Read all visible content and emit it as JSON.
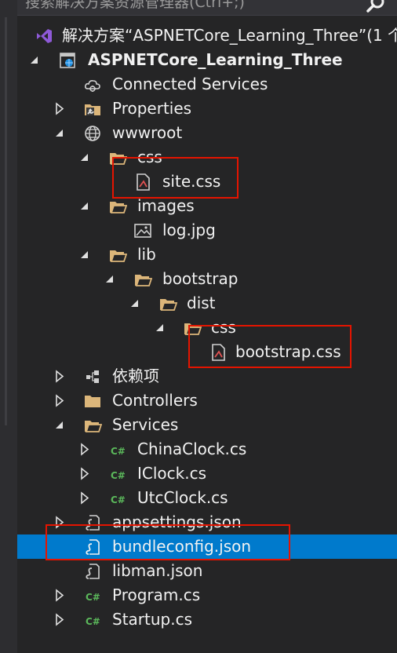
{
  "search": {
    "placeholder": "搜索解决方案资源管理器(Ctrl+;)"
  },
  "solution": {
    "label": "解决方案“ASPNETCore_Learning_Three”(1 个"
  },
  "project": {
    "label": "ASPNETCore_Learning_Three"
  },
  "tree": {
    "connected_services": "Connected Services",
    "properties": "Properties",
    "wwwroot": "wwwroot",
    "css": "css",
    "site_css": "site.css",
    "images": "images",
    "log_jpg": "log.jpg",
    "lib": "lib",
    "bootstrap": "bootstrap",
    "dist": "dist",
    "dist_css": "css",
    "bootstrap_css": "bootstrap.css",
    "dependencies": "依赖项",
    "controllers": "Controllers",
    "services": "Services",
    "china_clock": "ChinaClock.cs",
    "iclock": "IClock.cs",
    "utc_clock": "UtcClock.cs",
    "appsettings": "appsettings.json",
    "bundleconfig": "bundleconfig.json",
    "libman": "libman.json",
    "program": "Program.cs",
    "startup": "Startup.cs"
  },
  "icon_glyphs": {
    "csharp": "C#"
  },
  "colors": {
    "background": "#252526",
    "selection": "#007acc",
    "folder": "#dcb67a",
    "csharp": "#5bb85b",
    "highlight_box": "#e51400",
    "vs_purple": "#8f5ad8"
  }
}
